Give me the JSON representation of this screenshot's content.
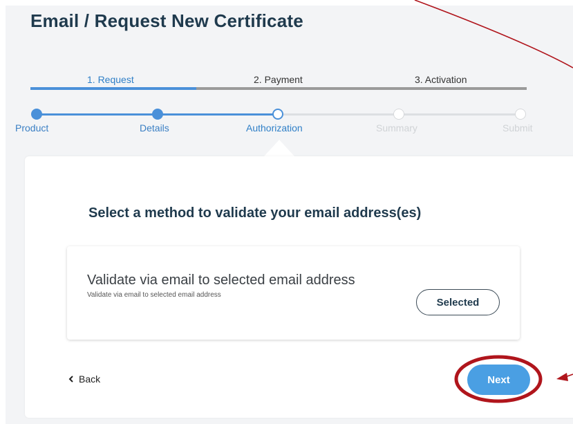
{
  "page": {
    "title": "Email / Request New Certificate"
  },
  "phases": [
    {
      "label": "1. Request",
      "state": "active"
    },
    {
      "label": "2. Payment",
      "state": "inactive"
    },
    {
      "label": "3. Activation",
      "state": "inactive"
    }
  ],
  "steps": [
    {
      "label": "Product",
      "state": "done"
    },
    {
      "label": "Details",
      "state": "done"
    },
    {
      "label": "Authorization",
      "state": "current"
    },
    {
      "label": "Summary",
      "state": "pending"
    },
    {
      "label": "Submit",
      "state": "pending"
    }
  ],
  "main": {
    "heading": "Select a method to validate your email address(es)",
    "option": {
      "title": "Validate via email to selected email address",
      "description": "Validate via email to selected email address",
      "button_label": "Selected"
    }
  },
  "footer": {
    "back_label": "Back",
    "next_label": "Next"
  },
  "colors": {
    "accent": "#4a90d9",
    "title": "#1f3a4d",
    "annotation": "#b0151c"
  },
  "icons": {
    "back": "chevron-left-icon"
  }
}
